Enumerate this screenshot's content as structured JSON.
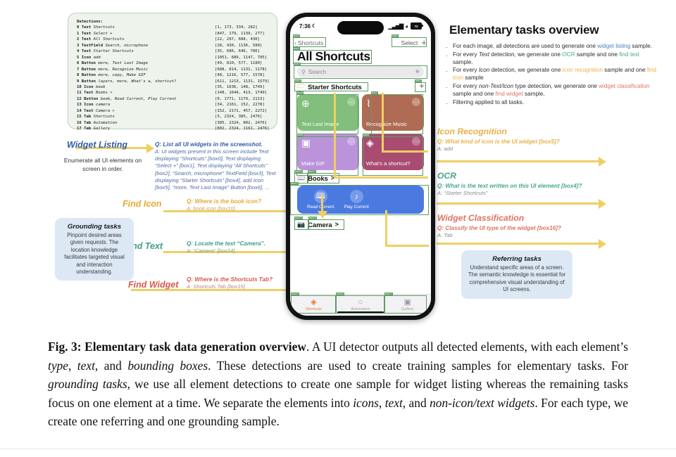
{
  "detections": {
    "title": "Detections:",
    "rows": [
      {
        "idx": "0",
        "type": "Text",
        "text": "Shortcuts",
        "box": "[1, 173, 334, 282]"
      },
      {
        "idx": "1",
        "type": "Text",
        "text": "Select +",
        "box": "[847, 179, 1139, 277]"
      },
      {
        "idx": "2",
        "type": "Text",
        "text": "All Shortcuts",
        "box": "[22, 297, 688, 430]"
      },
      {
        "idx": "3",
        "type": "TextField",
        "text": "Search, microphone",
        "box": "[28, 430, 1136, 580]"
      },
      {
        "idx": "4",
        "type": "Text",
        "text": "Starter Shortcuts",
        "box": "[35, 686, 646, 786]"
      },
      {
        "idx": "5",
        "type": "Icon",
        "text": "add",
        "box": "[1051, 689, 1147, 785]"
      },
      {
        "idx": "6",
        "type": "Button",
        "text": "more, Text Last Image",
        "box": "[49, 810, 577, 1180]"
      },
      {
        "idx": "7",
        "type": "Button",
        "text": "more, Recognize Music",
        "box": "[688, 814, 1131, 1178]"
      },
      {
        "idx": "8",
        "type": "Button",
        "text": "more, copy, Make GIF",
        "box": "[48, 1216, 577, 1578]"
      },
      {
        "idx": "9",
        "type": "Button",
        "text": "layers, more, What's a, shortcut?",
        "box": "[611, 1213, 1131, 1579]"
      },
      {
        "idx": "10",
        "type": "Icon",
        "text": "book",
        "box": "[35, 1636, 148, 1749]"
      },
      {
        "idx": "11",
        "type": "Text",
        "text": "Books >",
        "box": "[148, 1644, 413, 1749]"
      },
      {
        "idx": "12",
        "type": "Button",
        "text": "book, Read Current, Play Current",
        "box": "[0, 1771, 1179, 2113]"
      },
      {
        "idx": "13",
        "type": "Icon",
        "text": "camera",
        "box": "[34, 2161, 152, 2278]"
      },
      {
        "idx": "14",
        "type": "Text",
        "text": "Camera >",
        "box": "[152, 2171, 457, 2272]"
      },
      {
        "idx": "15",
        "type": "Tab",
        "text": "Shortcuts",
        "box": "[3, 2324, 385, 2476]"
      },
      {
        "idx": "16",
        "type": "Tab",
        "text": "Automation",
        "box": "[385, 2324, 802, 2476]"
      },
      {
        "idx": "17",
        "type": "Tab",
        "text": "Gallery",
        "box": "[802, 2324, 1161, 2476]"
      }
    ]
  },
  "left_column": {
    "widget_listing": {
      "label": "Widget Listing",
      "note": "Enumerate all UI elements on screen in order.",
      "q": "Q: List all UI widgets in the screenshot.",
      "a": "A: UI widgets present in this screen include Text displaying “Shortcuts” [box0], Text displaying “Select +” [box1], Text displaying “All Shortcuts” [box2], “Search, microphone” TextField [box3], Text displaying “Starter Shortcuts” [box4], add Icon [box5], “more, Text Last Image” Button [box6], ..."
    },
    "find_icon": {
      "label": "Find Icon",
      "q": "Q: Where is the book icon?",
      "a": "A: book icon [box10]"
    },
    "find_text": {
      "label": "Find Text",
      "q": "Q: Locate the text “Camera”.",
      "a": "A: “Camera” [box14]"
    },
    "find_widget": {
      "label": "Find Widget",
      "q": "Q: Where is the Shortcuts Tab?",
      "a": "A: Shortcuts Tab [box15]"
    },
    "grounding_card": {
      "title": "Grounding tasks",
      "body": "Pinpoint desired areas given requests. The location knowledge facilitates targeted visual and interaction understanding."
    }
  },
  "right_column": {
    "title": "Elementary tasks overview",
    "bullets": [
      {
        "parts": [
          {
            "t": "For each image, all detections are used to generate one ",
            "s": "plain"
          },
          {
            "t": "widget listing",
            "s": "blue"
          },
          {
            "t": " sample.",
            "s": "plain"
          }
        ]
      },
      {
        "parts": [
          {
            "t": "For every ",
            "s": "plain"
          },
          {
            "t": "Text",
            "s": "italic"
          },
          {
            "t": " detection, we generate one ",
            "s": "plain"
          },
          {
            "t": "OCR",
            "s": "teal"
          },
          {
            "t": " sample and one ",
            "s": "plain"
          },
          {
            "t": "find text",
            "s": "teal"
          },
          {
            "t": " sample.",
            "s": "plain"
          }
        ]
      },
      {
        "parts": [
          {
            "t": "For every ",
            "s": "plain"
          },
          {
            "t": "Icon",
            "s": "italic"
          },
          {
            "t": " detection, we generate one ",
            "s": "plain"
          },
          {
            "t": "icon recognition",
            "s": "yellow"
          },
          {
            "t": " sample and one ",
            "s": "plain"
          },
          {
            "t": "find icon",
            "s": "yellow"
          },
          {
            "t": " sample",
            "s": "plain"
          }
        ]
      },
      {
        "parts": [
          {
            "t": "For every ",
            "s": "plain"
          },
          {
            "t": "non-Text/Icon",
            "s": "italic"
          },
          {
            "t": " type detection, we generate one ",
            "s": "plain"
          },
          {
            "t": "widget classification",
            "s": "red"
          },
          {
            "t": " sample and one ",
            "s": "plain"
          },
          {
            "t": "find widget",
            "s": "red"
          },
          {
            "t": " sample.",
            "s": "plain"
          }
        ]
      },
      {
        "parts": [
          {
            "t": "Filtering applied to all tasks.",
            "s": "plain"
          }
        ]
      }
    ],
    "icon_recognition": {
      "label": "Icon Recognition",
      "q": "Q: What kind of icon is the UI widget [box5]?",
      "a": "A: add"
    },
    "ocr": {
      "label": "OCR",
      "q": "Q: What is the text written on this UI element [box4]?",
      "a": "A: “Starter Shortcuts”"
    },
    "widget_classification": {
      "label": "Widget Classification",
      "q": "Q: Classify the UI type of the widget [box16]?",
      "a": "A: Tab"
    },
    "referring_card": {
      "title": "Referring tasks",
      "body": "Understand specific areas of a screen. The semantic knowledge is essential for comprehensive visual understanding of UI screens."
    }
  },
  "phone": {
    "status": {
      "time": "7:36",
      "dnd_icon": "crescent-moon",
      "signal_icon": "cellular-bars",
      "wifi_icon": "wifi",
      "battery_level": "72"
    },
    "nav": {
      "back_label": "Shortcuts",
      "select_label": "Select",
      "add_label": "+"
    },
    "page_title": "All Shortcuts",
    "search": {
      "placeholder": "Search",
      "mic_icon": "microphone"
    },
    "sections": [
      {
        "name": "Starter Shortcuts",
        "icon": "folder-icon",
        "action": "+"
      },
      {
        "name": "Books",
        "icon": "book-icon",
        "action": ">"
      },
      {
        "name": "Camera",
        "icon": "camera-icon",
        "action": ">"
      }
    ],
    "tiles": [
      {
        "label": "Text Last Image",
        "color": "#82be7c",
        "glyph": "message-plus-icon"
      },
      {
        "label": "Recognize Music",
        "color": "#b06b54",
        "glyph": "waveform-icon"
      },
      {
        "label": "Make GIF",
        "color": "#bb93db",
        "glyph": "photos-icon"
      },
      {
        "label": "What's a shortcut?",
        "color": "#aa4c72",
        "glyph": "layers-icon"
      }
    ],
    "blue_card": {
      "color": "#4a7ae0",
      "items": [
        {
          "label": "Read Current",
          "glyph": "book-open-icon"
        },
        {
          "label": "Play Current",
          "glyph": "headphones-icon"
        }
      ]
    },
    "tabs": [
      {
        "label": "Shortcuts",
        "state": "active",
        "glyph": "shortcuts-icon"
      },
      {
        "label": "Automation",
        "state": "idle",
        "glyph": "clock-icon"
      },
      {
        "label": "Gallery",
        "state": "idle",
        "glyph": "gallery-icon"
      }
    ],
    "box_labels": [
      "box0",
      "box1",
      "box2",
      "box3",
      "box4",
      "box5",
      "box6",
      "box7",
      "box8",
      "box9",
      "box10",
      "box11",
      "box12",
      "box13",
      "box14",
      "box15",
      "box16",
      "box17"
    ]
  },
  "caption": {
    "prefix": "Fig. 3: Elementary task data generation overview",
    "rest_1": ". A UI detector outputs all detected elements, with each element’s ",
    "it_1": "type",
    "sep_1": ", ",
    "it_2": "text",
    "sep_2": ", and ",
    "it_3": "bounding boxes",
    "rest_2": ". These detections are used to create training samples for elementary tasks. For ",
    "it_4": "grounding tasks",
    "rest_3": ", we use all element detections to create one sample for widget listing whereas the remaining tasks focus on one element at a time. We separate the elements into ",
    "it_5": "icons",
    "sep_3": ", ",
    "it_6": "text",
    "sep_4": ", and ",
    "it_7": "non-icon/text widgets",
    "rest_4": ". For each type, we create one referring and one grounding sample."
  },
  "colors": {
    "arrow": "#f0cf62",
    "blue": "#2f5fa8",
    "teal": "#3b9e86",
    "yellow": "#e8b14a",
    "red": "#d9584f",
    "green_box": "#5d9c62",
    "panel_bg": "#eef3ec",
    "card_bg": "#dde8f5"
  }
}
